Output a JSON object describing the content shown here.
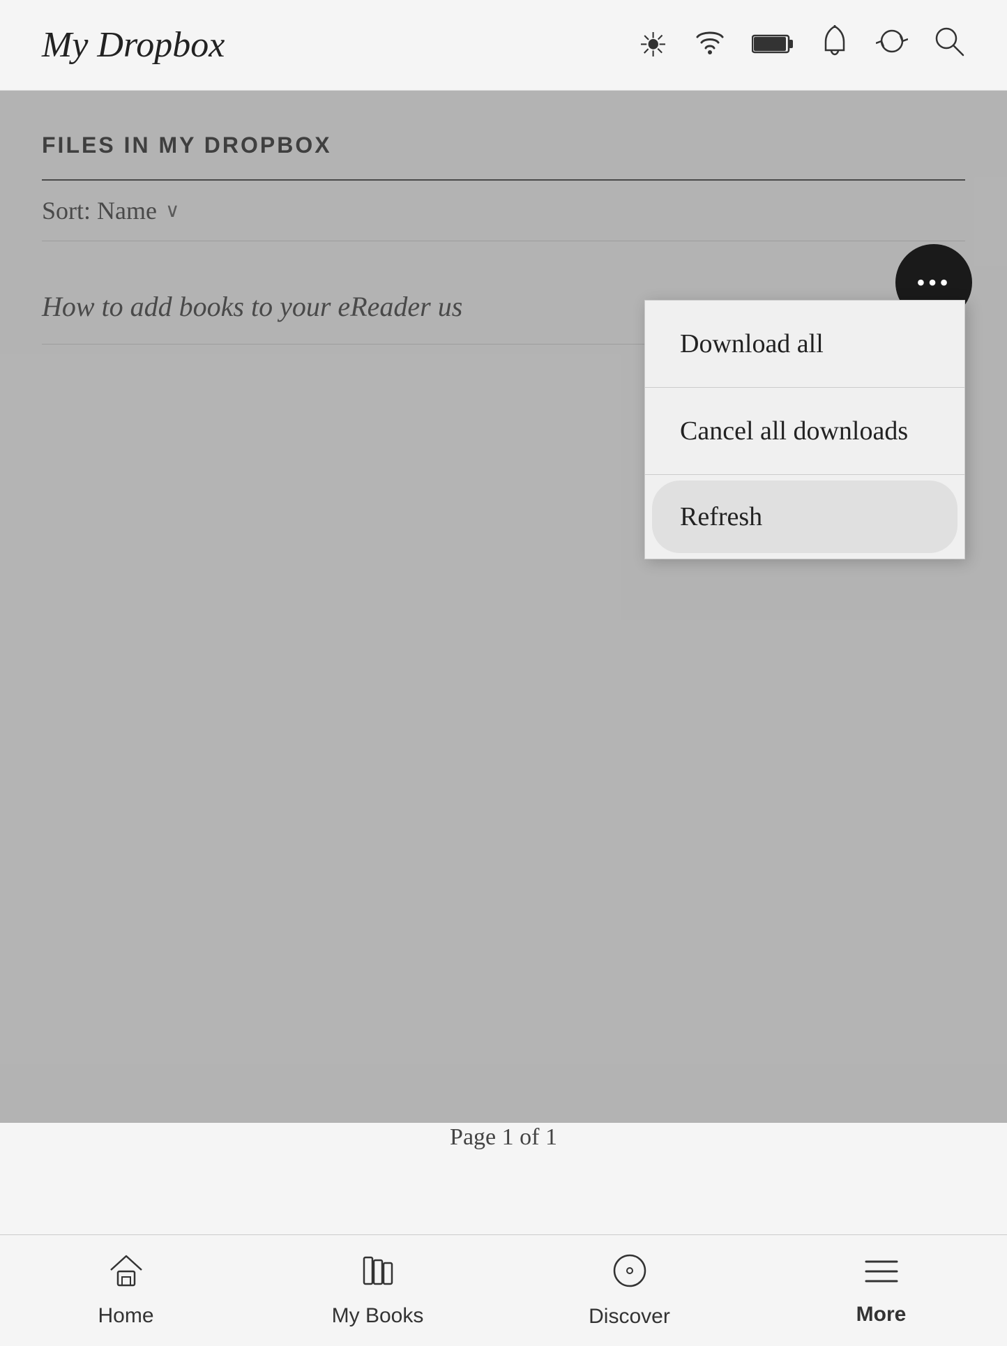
{
  "header": {
    "title": "My Dropbox",
    "icons": [
      {
        "name": "brightness-icon",
        "symbol": "☀"
      },
      {
        "name": "wifi-icon",
        "symbol": "⌾"
      },
      {
        "name": "battery-icon",
        "symbol": "▬"
      },
      {
        "name": "notification-icon",
        "symbol": "🔔"
      },
      {
        "name": "sync-icon",
        "symbol": "↻"
      },
      {
        "name": "search-icon",
        "symbol": "⌕"
      }
    ]
  },
  "section": {
    "title": "FILES IN MY DROPBOX",
    "sort_label": "Sort: Name",
    "sort_icon": "∨"
  },
  "file": {
    "name": "How to add books to your eReader us"
  },
  "dropdown": {
    "items": [
      {
        "label": "Download all",
        "active": false
      },
      {
        "label": "Cancel all downloads",
        "active": false
      },
      {
        "label": "Refresh",
        "active": true
      }
    ]
  },
  "more_button": {
    "dots": "•••"
  },
  "pagination": {
    "text": "Page 1 of 1"
  },
  "bottom_nav": {
    "items": [
      {
        "label": "Home",
        "icon": "⌂",
        "bold": false
      },
      {
        "label": "My Books",
        "icon": "📚",
        "bold": false
      },
      {
        "label": "Discover",
        "icon": "◎",
        "bold": false
      },
      {
        "label": "More",
        "icon": "☰",
        "bold": true
      }
    ]
  }
}
